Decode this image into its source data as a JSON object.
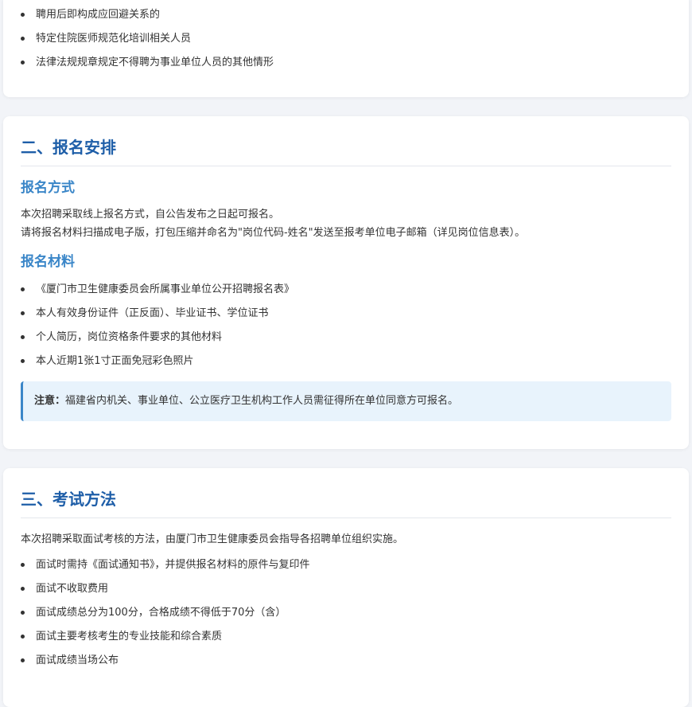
{
  "top_section": {
    "items": [
      "聘用后即构成应回避关系的",
      "特定住院医师规范化培训相关人员",
      "法律法规规章规定不得聘为事业单位人员的其他情形"
    ]
  },
  "registration": {
    "title": "二、报名安排",
    "method_title": "报名方式",
    "method_lines": [
      "本次招聘采取线上报名方式，自公告发布之日起可报名。",
      "请将报名材料扫描成电子版，打包压缩并命名为\"岗位代码-姓名\"发送至报考单位电子邮箱（详见岗位信息表）。"
    ],
    "materials_title": "报名材料",
    "materials": [
      "《厦门市卫生健康委员会所属事业单位公开招聘报名表》",
      "本人有效身份证件（正反面）、毕业证书、学位证书",
      "个人简历，岗位资格条件要求的其他材料",
      "本人近期1张1寸正面免冠彩色照片"
    ],
    "note_label": "注意：",
    "note_text": "福建省内机关、事业单位、公立医疗卫生机构工作人员需征得所在单位同意方可报名。"
  },
  "exam": {
    "title": "三、考试方法",
    "intro": "本次招聘采取面试考核的方法，由厦门市卫生健康委员会指导各招聘单位组织实施。",
    "items": [
      "面试时需持《面试通知书》，并提供报名材料的原件与复印件",
      "面试不收取费用",
      "面试成绩总分为100分，合格成绩不得低于70分（含）",
      "面试主要考核考生的专业技能和综合素质",
      "面试成绩当场公布"
    ]
  },
  "colors": {
    "section_title": "#1e5ea8",
    "sub_title": "#3a86c8",
    "note_background": "#e8f3fc",
    "note_border": "#3a86c8",
    "page_background": "#f2f4f8"
  }
}
